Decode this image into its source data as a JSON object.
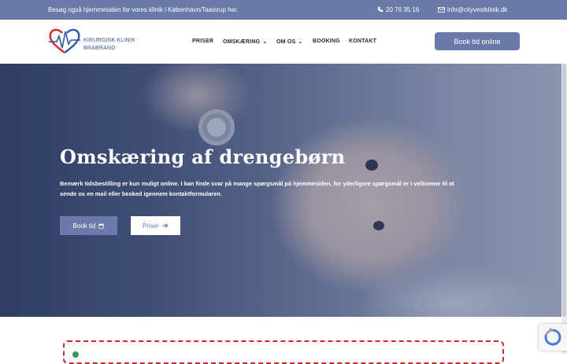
{
  "topbar": {
    "notice": "Besøg også hjemmesiden for vores klinik i København/Taastrup her.",
    "phone": "20 76 35 16",
    "email": "info@cityvestklinik.dk",
    "icons": [
      "phone-icon",
      "mail-icon"
    ]
  },
  "logo": {
    "line1": "KIRURGISK KLINIK",
    "line2": "BRABRAND"
  },
  "nav": {
    "items": [
      {
        "label": "PRISER"
      },
      {
        "label": "OMSKÆRING",
        "dropdown": true
      },
      {
        "label": "OM OS",
        "dropdown": true
      },
      {
        "label": "BOOKING"
      },
      {
        "label": "KONTAKT"
      }
    ]
  },
  "header": {
    "cta": "Book tid online"
  },
  "hero": {
    "title": "Omskæring af drengebørn",
    "text": "Bemærk tidsbestilling er kun muligt online. I kan finde svar på mange spørgsmål på hjemmesiden, for yderligere spørgsmål er I velkomne til at sende os en mail eller besked igennem kontaktformularen.",
    "book_button": "Book tid",
    "price_button": "Priser"
  },
  "colors": {
    "accent": "#6b7aa8",
    "alert_border": "#d62828"
  }
}
